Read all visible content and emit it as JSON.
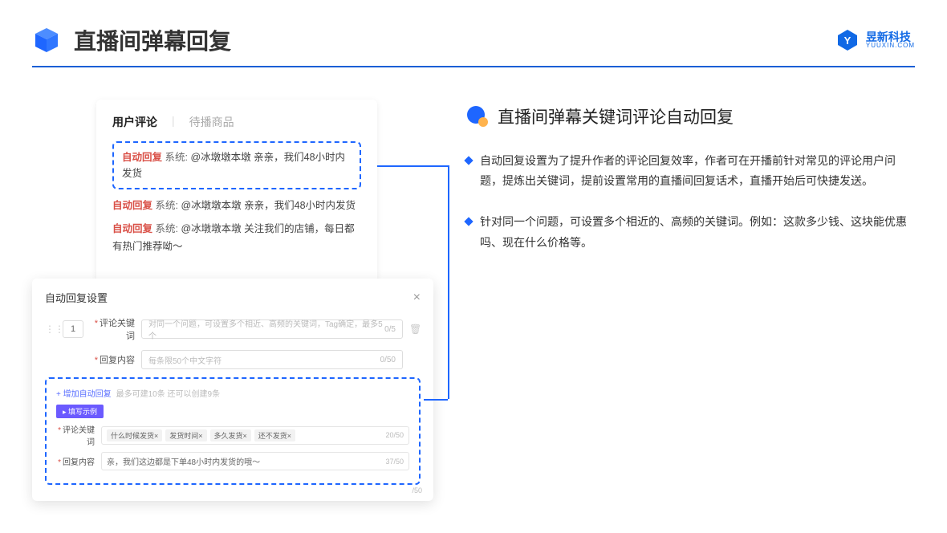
{
  "header": {
    "title": "直播间弹幕回复",
    "brand_name": "昱新科技",
    "brand_url": "YUUXIN.COM"
  },
  "card": {
    "tab_active": "用户评论",
    "tab_inactive": "待播商品",
    "r1_tag": "自动回复",
    "r1_sys": "系统:",
    "r1_text": "@冰墩墩本墩 亲亲，我们48小时内发货",
    "r2_tag": "自动回复",
    "r2_sys": "系统:",
    "r2_text": "@冰墩墩本墩 亲亲，我们48小时内发货",
    "r3_tag": "自动回复",
    "r3_sys": "系统:",
    "r3_text": "@冰墩墩本墩 关注我们的店铺，每日都有热门推荐呦～"
  },
  "modal": {
    "title": "自动回复设置",
    "num": "1",
    "kw_label": "评论关键词",
    "kw_ph": "对同一个问题，可设置多个相近、高频的关键词，Tag确定，最多5个",
    "kw_cnt": "0/5",
    "ct_label": "回复内容",
    "ct_ph": "每条限50个中文字符",
    "ct_cnt": "0/50",
    "add": "+ 增加自动回复",
    "add_note": "最多可建10条 还可以创建9条",
    "badge": "▸ 填写示例",
    "ex_kw_label": "评论关键词",
    "chip1": "什么时候发货×",
    "chip2": "发货时间×",
    "chip3": "多久发货×",
    "chip4": "还不发货×",
    "ex_kw_cnt": "20/50",
    "ex_ct_label": "回复内容",
    "ex_ct_text": "亲，我们这边都是下单48小时内发货的哦～",
    "ex_ct_cnt": "37/50",
    "bottom_cnt": "/50"
  },
  "right": {
    "title": "直播间弹幕关键词评论自动回复",
    "b1": "自动回复设置为了提升作者的评论回复效率，作者可在开播前针对常见的评论用户问题，提炼出关键词，提前设置常用的直播间回复话术，直播开始后可快捷发送。",
    "b2": "针对同一个问题，可设置多个相近的、高频的关键词。例如：这款多少钱、这块能优惠吗、现在什么价格等。"
  }
}
